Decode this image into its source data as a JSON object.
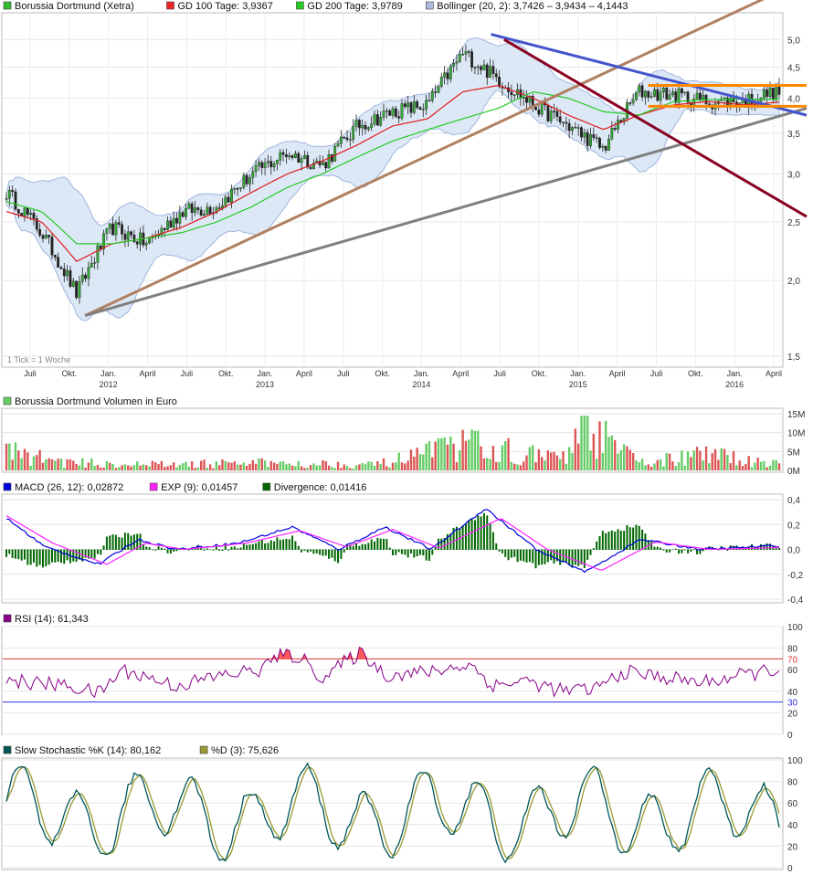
{
  "colors": {
    "price": "#333333",
    "gd100": "#e01b1b",
    "gd200": "#22cc22",
    "boll_fill": "#dde8f6",
    "boll_line": "#9fb6dd",
    "volume_green": "#66cc66",
    "volume_red": "#dd5555",
    "macd": "#0000dd",
    "exp": "#ff22ff",
    "divergence": "#006600",
    "rsi": "#880088",
    "rsi_fill": "#ff5555",
    "stoch_k": "#005555",
    "stoch_d": "#999933"
  },
  "main": {
    "legend": [
      {
        "label": "Borussia Dortmund (Xetra)",
        "color": "#33bb33"
      },
      {
        "label": "GD 100 Tage: 3,9367",
        "color": "#ee2222"
      },
      {
        "label": "GD 200 Tage: 3,9789",
        "color": "#22cc22"
      },
      {
        "label": "Bollinger (20, 2): 3,7426 – 3,9434 – 4,1443",
        "color": "#aabbdd"
      }
    ],
    "tick_note": "1 Tick = 1 Woche",
    "y_ticks": [
      "5,0",
      "4,5",
      "4,0",
      "3,5",
      "3,0",
      "2,5",
      "2,0",
      "1,5"
    ],
    "y_tick_values": [
      5.0,
      4.5,
      4.0,
      3.5,
      3.0,
      2.5,
      2.0,
      1.5
    ],
    "month_labels": [
      "Juli",
      "Okt.",
      "Jan.",
      "April",
      "Juli",
      "Okt.",
      "Jan.",
      "April",
      "Juli",
      "Okt.",
      "Jan.",
      "April",
      "Juli",
      "Okt.",
      "Jan.",
      "April",
      "Juli",
      "Okt.",
      "Jan.",
      "April"
    ],
    "year_labels": [
      "2012",
      "2013",
      "2014",
      "2015",
      "2016"
    ]
  },
  "volume": {
    "legend": [
      {
        "label": "Borussia Dortmund Volumen in Euro",
        "color": "#66cc66"
      }
    ],
    "y_ticks": [
      "15M",
      "10M",
      "5M",
      "0M"
    ],
    "y_tick_values": [
      15,
      10,
      5,
      0
    ]
  },
  "macd": {
    "legend": [
      {
        "label": "MACD (26, 12): 0,02872",
        "color": "#0000dd"
      },
      {
        "label": "EXP (9): 0,01457",
        "color": "#ff22ff"
      },
      {
        "label": "Divergence: 0,01416",
        "color": "#006600"
      }
    ],
    "y_ticks": [
      "0,4",
      "0,2",
      "0,0",
      "-0,2",
      "-0,4"
    ],
    "y_tick_values": [
      0.4,
      0.2,
      0.0,
      -0.2,
      -0.4
    ]
  },
  "rsi": {
    "legend": [
      {
        "label": "RSI (14): 61,343",
        "color": "#880088"
      }
    ],
    "y_ticks": [
      "100",
      "80",
      "70",
      "60",
      "40",
      "30",
      "20",
      "0"
    ],
    "y_tick_values": [
      100,
      80,
      70,
      60,
      40,
      30,
      20,
      0
    ]
  },
  "stoch": {
    "legend": [
      {
        "label": "Slow Stochastic %K (14): 80,162",
        "color": "#005555"
      },
      {
        "label": "%D (3): 75,626",
        "color": "#999933"
      }
    ],
    "y_ticks": [
      "100",
      "80",
      "60",
      "40",
      "20",
      "0"
    ],
    "y_tick_values": [
      100,
      80,
      60,
      40,
      20,
      0
    ]
  },
  "chart_data": [
    {
      "type": "line",
      "title": "Borussia Dortmund (Xetra)",
      "x": [
        "2011-06",
        "2011-09",
        "2011-12",
        "2012-03",
        "2012-06",
        "2012-09",
        "2012-12",
        "2013-03",
        "2013-06",
        "2013-09",
        "2013-12",
        "2014-03",
        "2014-06",
        "2014-07",
        "2014-09",
        "2014-12",
        "2015-03",
        "2015-06",
        "2015-07",
        "2015-09",
        "2015-12",
        "2016-03",
        "2016-05"
      ],
      "series": [
        {
          "name": "Borussia Dortmund (Xetra)",
          "values": [
            2.8,
            2.4,
            1.9,
            2.45,
            2.3,
            2.6,
            2.65,
            3.0,
            3.25,
            3.1,
            3.6,
            3.8,
            3.9,
            4.75,
            4.3,
            3.9,
            3.6,
            3.3,
            4.1,
            4.05,
            3.95,
            3.95,
            4.12
          ]
        },
        {
          "name": "GD 100 Tage: 3,9367",
          "values": [
            2.6,
            2.5,
            2.15,
            2.3,
            2.35,
            2.45,
            2.6,
            2.8,
            3.0,
            3.15,
            3.35,
            3.6,
            3.7,
            4.1,
            4.2,
            4.0,
            3.75,
            3.55,
            3.75,
            3.9,
            3.95,
            3.9,
            3.94
          ]
        },
        {
          "name": "GD 200 Tage: 3,9789",
          "values": [
            2.7,
            2.6,
            2.3,
            2.3,
            2.35,
            2.4,
            2.5,
            2.65,
            2.85,
            3.0,
            3.2,
            3.4,
            3.55,
            3.7,
            3.85,
            4.1,
            4.0,
            3.8,
            3.75,
            3.95,
            3.98,
            3.99,
            3.98
          ]
        }
      ],
      "ylim": [
        1.5,
        5.2
      ],
      "scale": "log",
      "trendlines": [
        {
          "color": "#b08060",
          "from": [
            "2011-12",
            1.75
          ],
          "to": [
            "2016-05",
            6.3
          ]
        },
        {
          "color": "#808080",
          "from": [
            "2011-12",
            1.75
          ],
          "to": [
            "2016-05",
            3.85
          ]
        },
        {
          "color": "#4455cc",
          "from": [
            "2014-07",
            5.1
          ],
          "to": [
            "2016-05",
            3.75
          ]
        },
        {
          "color": "#880022",
          "from": [
            "2014-08",
            5.0
          ],
          "to": [
            "2016-05",
            2.55
          ]
        },
        {
          "color": "#ff8800",
          "from": [
            "2015-07",
            4.2
          ],
          "to": [
            "2016-05",
            4.2
          ]
        },
        {
          "color": "#ff8800",
          "from": [
            "2015-07",
            3.88
          ],
          "to": [
            "2016-05",
            3.88
          ]
        }
      ]
    },
    {
      "type": "bar",
      "title": "Borussia Dortmund Volumen in Euro",
      "ylabel": "Volumen in Euro (M)",
      "ylim": [
        0,
        15
      ],
      "profile": [
        [
          0,
          5
        ],
        [
          0.08,
          2
        ],
        [
          0.2,
          1.5
        ],
        [
          0.35,
          2
        ],
        [
          0.48,
          1.5
        ],
        [
          0.6,
          7
        ],
        [
          0.68,
          4
        ],
        [
          0.72,
          3
        ],
        [
          0.75,
          11
        ],
        [
          0.82,
          2
        ],
        [
          0.9,
          4
        ],
        [
          1,
          2
        ]
      ]
    },
    {
      "type": "line",
      "title": "MACD",
      "ylim": [
        -0.4,
        0.4
      ],
      "series": [
        {
          "name": "MACD (26, 12): 0,02872",
          "values_profile": [
            [
              0,
              0.25
            ],
            [
              0.05,
              0.02
            ],
            [
              0.12,
              -0.12
            ],
            [
              0.17,
              0.08
            ],
            [
              0.22,
              0.0
            ],
            [
              0.3,
              0.05
            ],
            [
              0.37,
              0.18
            ],
            [
              0.43,
              0.0
            ],
            [
              0.49,
              0.18
            ],
            [
              0.55,
              0.0
            ],
            [
              0.62,
              0.33
            ],
            [
              0.69,
              -0.02
            ],
            [
              0.75,
              -0.18
            ],
            [
              0.82,
              0.08
            ],
            [
              0.9,
              0.0
            ],
            [
              1,
              0.03
            ]
          ]
        },
        {
          "name": "EXP (9): 0,01457",
          "values_profile": [
            [
              0,
              0.27
            ],
            [
              0.06,
              0.05
            ],
            [
              0.13,
              -0.12
            ],
            [
              0.18,
              0.05
            ],
            [
              0.23,
              0.0
            ],
            [
              0.31,
              0.05
            ],
            [
              0.38,
              0.15
            ],
            [
              0.44,
              0.02
            ],
            [
              0.5,
              0.16
            ],
            [
              0.56,
              0.01
            ],
            [
              0.64,
              0.25
            ],
            [
              0.7,
              0.0
            ],
            [
              0.77,
              -0.17
            ],
            [
              0.84,
              0.06
            ],
            [
              0.91,
              0.0
            ],
            [
              1,
              0.015
            ]
          ]
        }
      ]
    },
    {
      "type": "line",
      "title": "RSI (14)",
      "ylim": [
        0,
        100
      ],
      "reference_lines": [
        70,
        30
      ]
    },
    {
      "type": "line",
      "title": "Slow Stochastic",
      "ylim": [
        0,
        100
      ],
      "series": [
        {
          "name": "Slow Stochastic %K (14): 80,162"
        },
        {
          "name": "%D (3): 75,626"
        }
      ]
    }
  ]
}
